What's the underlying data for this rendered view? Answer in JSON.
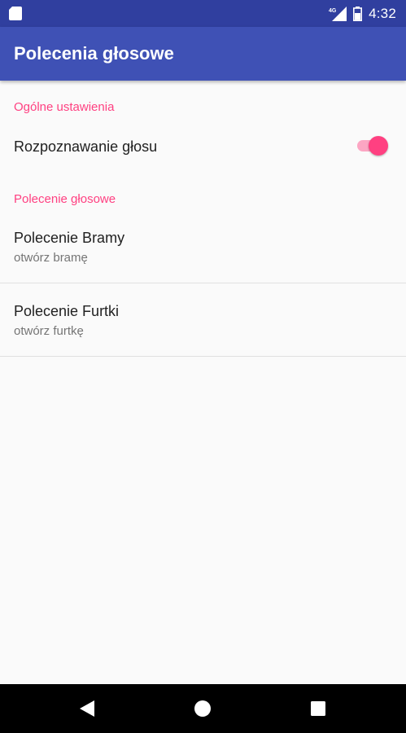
{
  "status_bar": {
    "time": "4:32",
    "network_label": "4G",
    "icons": [
      "sim-card-icon",
      "signal-4g-icon",
      "battery-icon"
    ]
  },
  "app_bar": {
    "title": "Polecenia głosowe"
  },
  "sections": [
    {
      "header": "Ogólne ustawienia",
      "items": [
        {
          "title": "Rozpoznawanie głosu",
          "switch_on": true
        }
      ]
    },
    {
      "header": "Polecenie głosowe",
      "items": [
        {
          "title": "Polecenie Bramy",
          "summary": "otwórz bramę"
        },
        {
          "title": "Polecenie Furtki",
          "summary": "otwórz furtkę"
        }
      ]
    }
  ],
  "nav_bar": {
    "buttons": [
      "back-icon",
      "home-icon",
      "recents-icon"
    ]
  },
  "colors": {
    "primary": "#3f51b5",
    "primary_dark": "#303f9f",
    "accent": "#ff4081",
    "background": "#fafafa",
    "title_text": "#212121",
    "summary_text": "#757575"
  }
}
